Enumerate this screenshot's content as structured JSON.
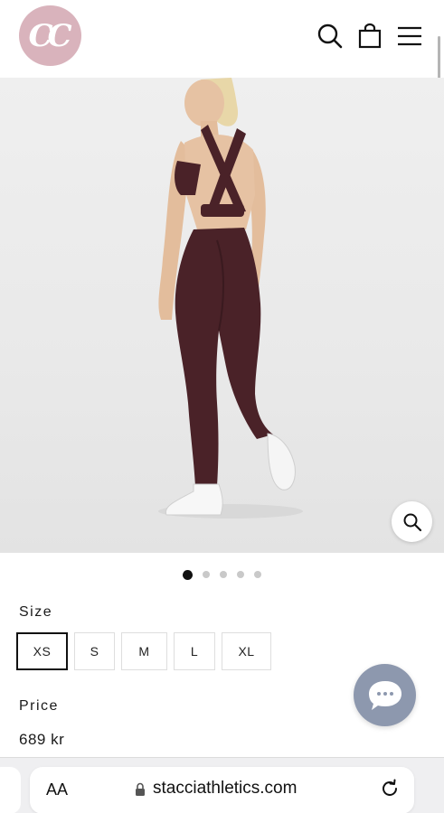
{
  "header": {
    "logo_text": "CC",
    "icons": [
      "search-icon",
      "bag-icon",
      "menu-icon"
    ]
  },
  "carousel": {
    "total_slides": 5,
    "active_index": 0
  },
  "size": {
    "label": "Size",
    "options": [
      "XS",
      "S",
      "M",
      "L",
      "XL"
    ],
    "selected": "XS"
  },
  "price": {
    "label": "Price",
    "value": "689 kr"
  },
  "browser": {
    "aa_label": "AA",
    "url": "stacciathletics.com"
  },
  "colors": {
    "logo_bg": "#d9b3bc",
    "chat_bg": "#8d98ae",
    "garment": "#4a2228"
  }
}
